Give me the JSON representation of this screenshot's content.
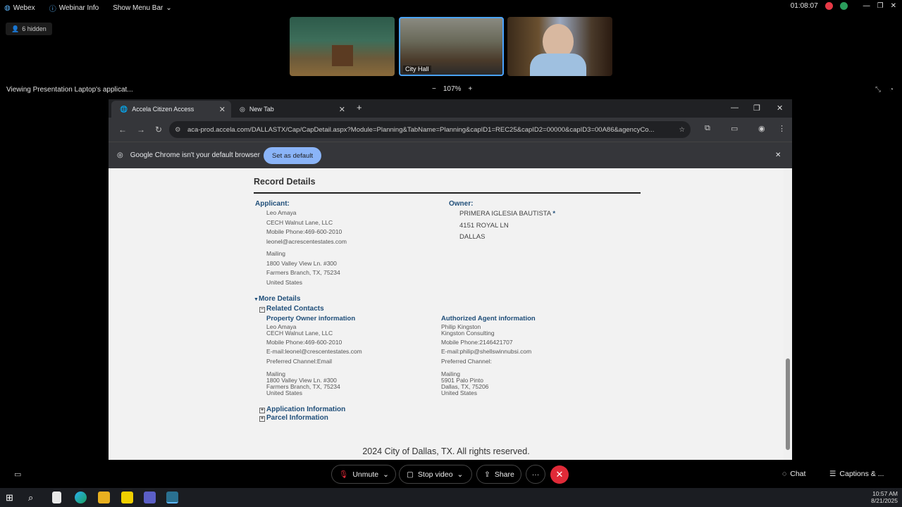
{
  "topbar": {
    "app_name": "Webex",
    "webinar_info": "Webinar Info",
    "show_menu": "Show Menu Bar",
    "timer": "01:08:07"
  },
  "hidden_label": "6 hidden",
  "thumbnails": {
    "city_hall": "City Hall"
  },
  "viewing_text": "Viewing Presentation Laptop's applicat...",
  "zoom": {
    "minus": "−",
    "level": "107%",
    "plus": "+"
  },
  "chrome": {
    "tab1": "Accela Citizen Access",
    "tab2": "New Tab",
    "url": "aca-prod.accela.com/DALLASTX/Cap/CapDetail.aspx?Module=Planning&TabName=Planning&capID1=REC25&capID2=00000&capID3=00A86&agencyCo...",
    "infobar_text": "Google Chrome isn't your default browser",
    "set_default": "Set as default"
  },
  "record": {
    "heading": "Record Details",
    "applicant_label": "Applicant:",
    "applicant_lines": [
      "Leo Amaya",
      "CECH Walnut Lane, LLC",
      "Mobile Phone:469-600-2010",
      "leonel@acrescentestates.com",
      "Mailing",
      "1800 Valley View Ln. #300",
      "Farmers Branch, TX, 75234",
      "United States"
    ],
    "owner_label": "Owner:",
    "owner_name": "PRIMERA IGLESIA BAUTISTA",
    "owner_star": "*",
    "owner_street": "4151 ROYAL LN",
    "owner_city": "DALLAS",
    "more_details": "More Details",
    "related_contacts": "Related Contacts",
    "property_owner_label": "Property Owner information",
    "po_name": "Leo Amaya",
    "po_company": "CECH Walnut Lane, LLC",
    "po_phone": "Mobile Phone:469-600-2010",
    "po_email": "E-mail:leonel@crescentestates.com",
    "po_channel": "Preferred Channel:Email",
    "po_mailing": "Mailing",
    "po_street": "1800 Valley View Ln. #300",
    "po_city": "Farmers Branch, TX, 75234",
    "po_country": "United States",
    "agent_label": "Authorized Agent information",
    "ag_name": "Philip Kingston",
    "ag_company": "Kingston Consulting",
    "ag_phone": "Mobile Phone:2146421707",
    "ag_email": "E-mail:philip@shellswinnubsi.com",
    "ag_channel": "Preferred Channel:",
    "ag_mailing": "Mailing",
    "ag_street": "5901 Palo Pinto",
    "ag_city": "Dallas, TX, 75206",
    "ag_country": "United States",
    "application_info": "Application Information",
    "parcel_info": "Parcel Information",
    "footer": "2024 City of Dallas, TX. All rights reserved."
  },
  "controls": {
    "unmute": "Unmute",
    "stop_video": "Stop video",
    "share": "Share",
    "more": "···",
    "chat": "Chat",
    "captions": "Captions & ..."
  },
  "clock": {
    "time": "10:57 AM",
    "date": "8/21/2025"
  },
  "colors": {
    "end_call": "#e02a38",
    "set_default": "#8ab4f8",
    "link_blue": "#1f4e79"
  }
}
